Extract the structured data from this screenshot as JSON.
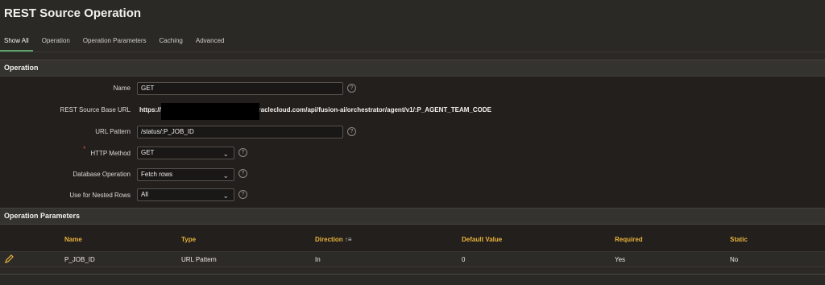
{
  "page": {
    "title": "REST Source Operation"
  },
  "tabs": [
    "Show All",
    "Operation",
    "Operation Parameters",
    "Caching",
    "Advanced"
  ],
  "operation": {
    "section_title": "Operation",
    "name_label": "Name",
    "name_value": "GET",
    "base_url_label": "REST Source Base URL",
    "base_url_prefix": "https://fa-",
    "base_url_suffix": ".oraclecloud.com/api/fusion-ai/orchestrator/agent/v1/:P_AGENT_TEAM_CODE",
    "url_pattern_label": "URL Pattern",
    "url_pattern_value": "/status/:P_JOB_ID",
    "http_method_label": "HTTP Method",
    "http_method_value": "GET",
    "db_operation_label": "Database Operation",
    "db_operation_value": "Fetch rows",
    "nested_rows_label": "Use for Nested Rows",
    "nested_rows_value": "All",
    "required_marker": "*",
    "help_glyph": "?",
    "chevron_glyph": "⌄"
  },
  "params": {
    "section_title": "Operation Parameters",
    "headers": {
      "name": "Name",
      "type": "Type",
      "direction": "Direction",
      "sort_glyph": "↑≡",
      "default_value": "Default Value",
      "required": "Required",
      "static": "Static"
    },
    "rows": [
      {
        "name": "P_JOB_ID",
        "type": "URL Pattern",
        "direction": "In",
        "default_value": "0",
        "required": "Yes",
        "static": "No"
      }
    ],
    "edit_icon_color": "#e9b23b"
  },
  "colors": {
    "accent_tab": "#5fa56b",
    "header_text": "#e9b23b",
    "required_star": "#d84a3c"
  }
}
